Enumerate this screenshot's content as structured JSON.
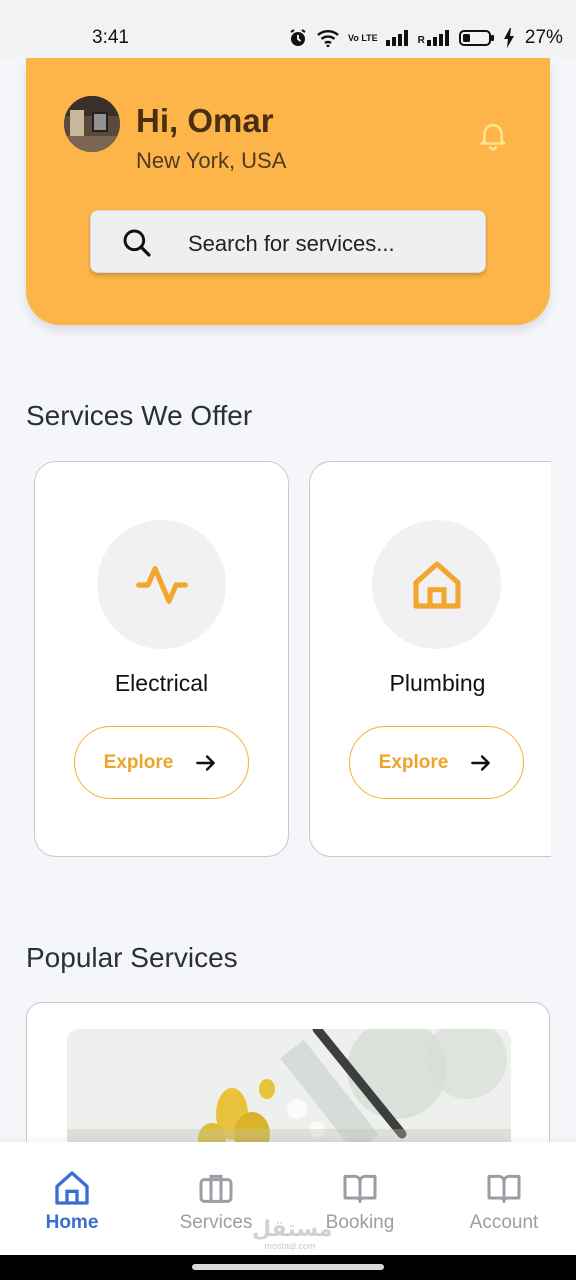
{
  "status_bar": {
    "time": "3:41",
    "battery_percent": "27%",
    "icons": [
      "alarm-icon",
      "wifi-icon",
      "volte-icon",
      "signal-icon",
      "roaming-signal-icon",
      "battery-icon",
      "charging-icon"
    ],
    "volte_label": "Vo LTE",
    "roaming_label": "R"
  },
  "header": {
    "greeting": "Hi, Omar",
    "location": "New York, USA",
    "accent_color": "#fdb54a"
  },
  "search": {
    "placeholder": "Search for services..."
  },
  "services_section": {
    "title": "Services We Offer",
    "cards": [
      {
        "name": "Electrical",
        "icon": "activity-icon",
        "button_label": "Explore"
      },
      {
        "name": "Plumbing",
        "icon": "home-icon",
        "button_label": "Explore"
      }
    ]
  },
  "popular_section": {
    "title": "Popular Services"
  },
  "bottom_nav": {
    "items": [
      {
        "label": "Home",
        "icon": "home-icon",
        "active": true
      },
      {
        "label": "Services",
        "icon": "briefcase-icon",
        "active": false
      },
      {
        "label": "Booking",
        "icon": "book-icon",
        "active": false
      },
      {
        "label": "Account",
        "icon": "book-open-icon",
        "active": false
      }
    ],
    "active_color": "#3a6fd1",
    "inactive_color": "#9a9ea6"
  },
  "watermark": {
    "text": "مستقل",
    "subtext": "mostaql.com"
  }
}
